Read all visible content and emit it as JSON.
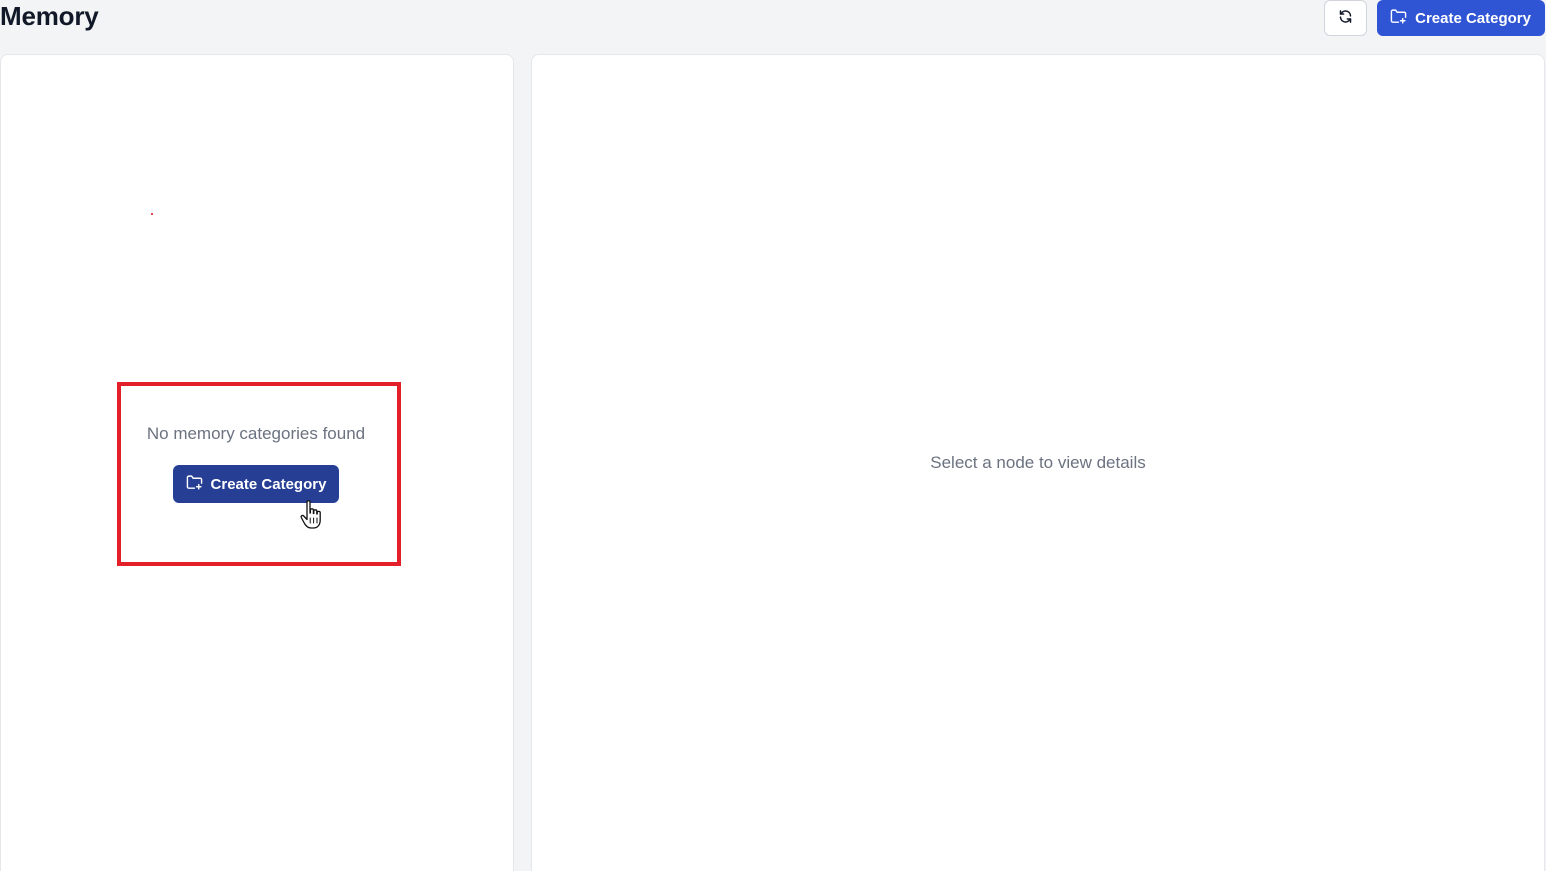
{
  "header": {
    "title": "Memory",
    "refresh_icon": "refresh-icon",
    "create_button_label": "Create Category",
    "create_button_icon": "folder-plus-icon"
  },
  "left_panel": {
    "empty_message": "No memory categories found",
    "create_button_label": "Create Category",
    "create_button_icon": "folder-plus-icon"
  },
  "right_panel": {
    "placeholder": "Select a node to view details"
  },
  "colors": {
    "primary": "#2f55d4",
    "primary_dark": "#263f94",
    "highlight": "#e3202a",
    "background": "#f3f4f6"
  }
}
